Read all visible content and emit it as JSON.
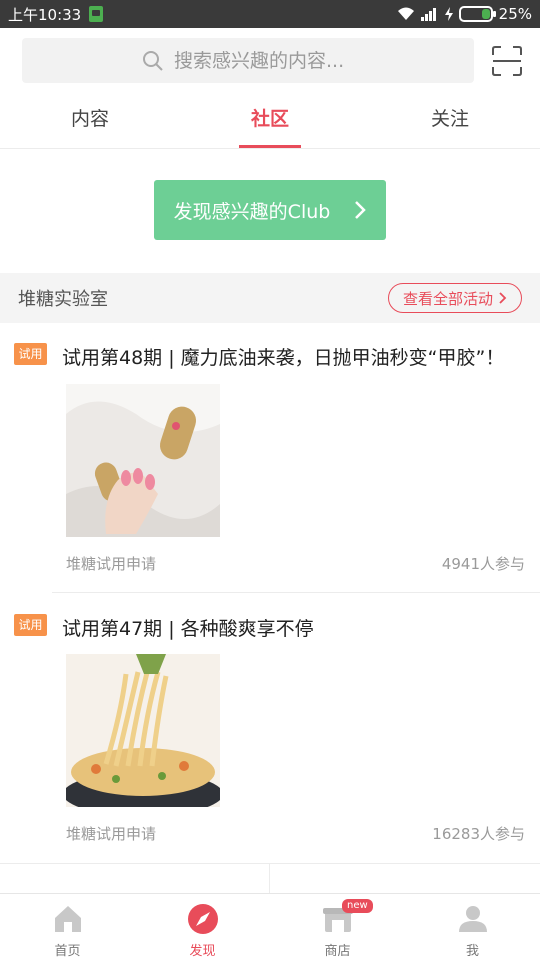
{
  "status_bar": {
    "time": "上午10:33",
    "battery": "25%"
  },
  "search": {
    "placeholder": "搜索感兴趣的内容..."
  },
  "tabs": [
    {
      "label": "内容",
      "active": false
    },
    {
      "label": "社区",
      "active": true
    },
    {
      "label": "关注",
      "active": false
    }
  ],
  "discover_club_label": "发现感兴趣的Club",
  "lab": {
    "title": "堆糖实验室",
    "see_all_label": "查看全部活动"
  },
  "trials": [
    {
      "badge": "试用",
      "title": "试用第48期 | 魔力底油来袭，日抛甲油秒变“甲胶”！",
      "source": "堆糖试用申请",
      "participants": "4941人参与"
    },
    {
      "badge": "试用",
      "title": "试用第47期 | 各种酸爽享不停",
      "source": "堆糖试用申请",
      "participants": "16283人参与"
    }
  ],
  "bottom_nav": [
    {
      "label": "首页",
      "icon": "home-icon",
      "active": false
    },
    {
      "label": "发现",
      "icon": "compass-icon",
      "active": true
    },
    {
      "label": "商店",
      "icon": "store-icon",
      "active": false,
      "badge": "new"
    },
    {
      "label": "我",
      "icon": "profile-icon",
      "active": false
    }
  ],
  "colors": {
    "accent": "#e84c5a",
    "club_button": "#6dcf95",
    "trial_badge": "#f7924a",
    "status_bar": "#3a3a3a"
  }
}
